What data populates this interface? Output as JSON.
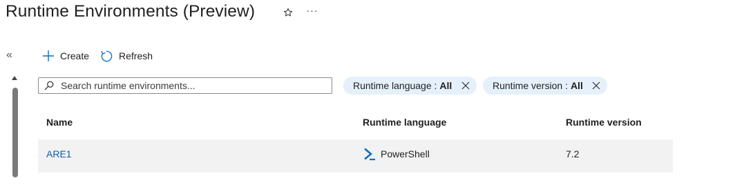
{
  "header": {
    "title": "Runtime Environments (Preview)",
    "favorite_icon": "star-icon",
    "more_icon": "ellipsis-icon",
    "more_label": "···"
  },
  "sidebar": {
    "collapse_icon": "double-chevron-left-icon",
    "collapse_label": "«"
  },
  "toolbar": {
    "create_label": "Create",
    "create_icon": "plus-icon",
    "refresh_label": "Refresh",
    "refresh_icon": "refresh-icon"
  },
  "search": {
    "placeholder": "Search runtime environments...",
    "value": "",
    "icon": "search-icon"
  },
  "filters": [
    {
      "label": "Runtime language : ",
      "value": "All",
      "remove_icon": "close-icon"
    },
    {
      "label": "Runtime version : ",
      "value": "All",
      "remove_icon": "close-icon"
    }
  ],
  "table": {
    "columns": [
      "Name",
      "Runtime language",
      "Runtime version"
    ],
    "rows": [
      {
        "name": "ARE1",
        "language": "PowerShell",
        "language_icon": "powershell-icon",
        "version": "7.2"
      }
    ]
  },
  "colors": {
    "accent": "#0f6cbd",
    "link": "#0f5ca8",
    "pill_bg": "#e6f0fa",
    "row_bg": "#f2f2f2",
    "scrollbar": "#7a7a7a"
  }
}
